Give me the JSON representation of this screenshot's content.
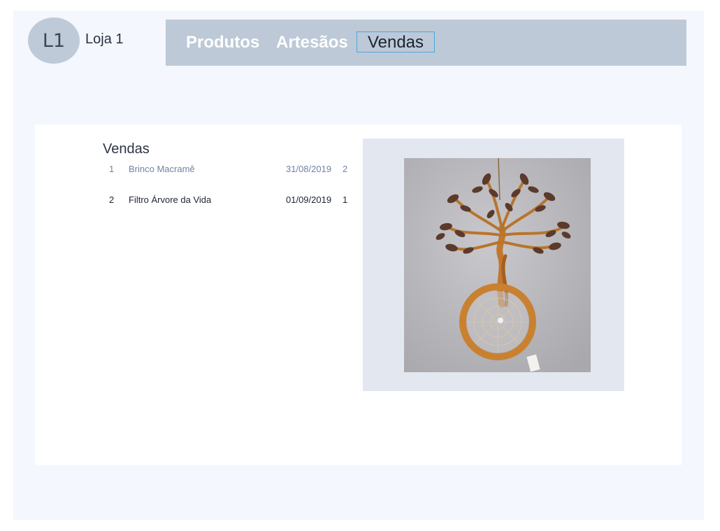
{
  "header": {
    "avatar_initials": "L1",
    "store_name": "Loja 1"
  },
  "nav": {
    "items": [
      {
        "label": "Produtos",
        "active": false
      },
      {
        "label": "Artesãos",
        "active": false
      },
      {
        "label": "Vendas",
        "active": true
      }
    ]
  },
  "main": {
    "title": "Vendas",
    "sales": [
      {
        "id": "1",
        "product": "Brinco Macramê",
        "date": "31/08/2019",
        "quantity": "2",
        "selected": true
      },
      {
        "id": "2",
        "product": "Filtro Árvore da Vida",
        "date": "01/09/2019",
        "quantity": "1",
        "selected": false
      }
    ],
    "preview": {
      "image_subject": "tree-of-life-dreamcatcher-photo"
    }
  },
  "colors": {
    "navbar": "#bdc9d7",
    "avatar": "#bfcad9",
    "active_border": "#4ca7dd",
    "selected_text": "#6f84a4",
    "page_background": "#f4f7fd",
    "preview_background": "#e2e7f0"
  }
}
